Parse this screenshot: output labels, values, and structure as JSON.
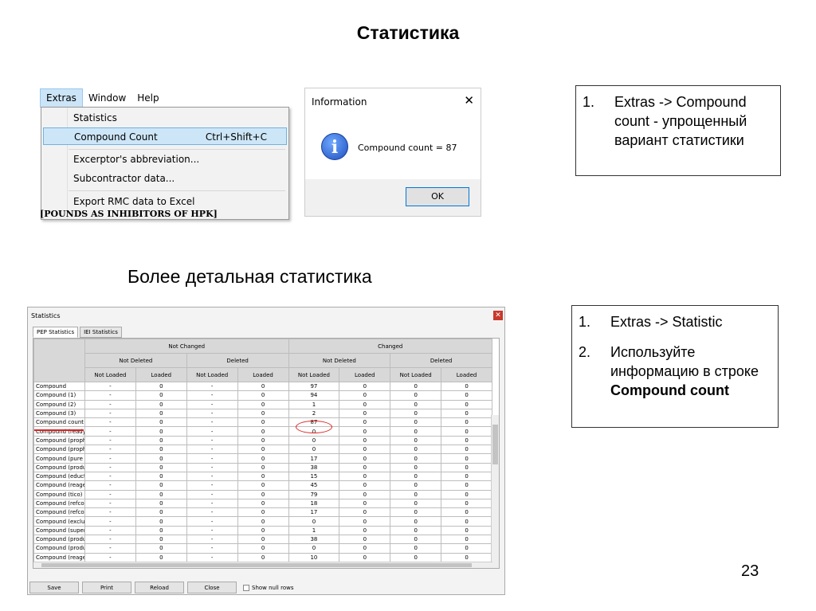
{
  "slide": {
    "title": "Статистика",
    "subtitle": "Более детальная статистика",
    "page_number": "23"
  },
  "callout1": {
    "items": [
      {
        "num": "1.",
        "text": "Extras -> Compound count - упрощенный вариант статистики"
      }
    ]
  },
  "callout2": {
    "items": [
      {
        "num": "1.",
        "text": "Extras -> Statistic"
      },
      {
        "num": "2.",
        "text_prefix": "Используйте информацию в строке ",
        "text_bold": "Compound count"
      }
    ]
  },
  "menu": {
    "bar": [
      "Extras",
      "Window",
      "Help"
    ],
    "items": [
      {
        "label": "Statistics",
        "shortcut": ""
      },
      {
        "label": "Compound Count",
        "shortcut": "Ctrl+Shift+C"
      },
      {
        "label": "Excerptor's abbreviation...",
        "shortcut": ""
      },
      {
        "label": "Subcontractor data...",
        "shortcut": ""
      },
      {
        "label": "Export RMC data to Excel",
        "shortcut": ""
      }
    ],
    "peek_text": "[POUNDS AS INHIBITORS OF HPK]"
  },
  "info_dialog": {
    "title": "Information",
    "close": "✕",
    "icon": "info-icon",
    "message": "Compound count = 87",
    "ok_label": "OK"
  },
  "stat_window": {
    "title": "Statistics",
    "close": "✕",
    "tabs": [
      "PEP Statistics",
      "IEI Statistics"
    ],
    "headers": {
      "top": [
        "Not Changed",
        "Changed"
      ],
      "mid": [
        "Not Deleted",
        "Deleted",
        "Not Deleted",
        "Deleted"
      ],
      "low": [
        "Not Loaded",
        "Loaded",
        "Not Loaded",
        "Loaded",
        "Not Loaded",
        "Loaded",
        "Not Loaded",
        "Loaded"
      ]
    },
    "rows": [
      [
        "Compound",
        "-",
        "0",
        "-",
        "0",
        "97",
        "0",
        "0",
        "0"
      ],
      [
        "Compound (1)",
        "-",
        "0",
        "-",
        "0",
        "94",
        "0",
        "0",
        "0"
      ],
      [
        "Compound (2)",
        "-",
        "0",
        "-",
        "0",
        "1",
        "0",
        "0",
        "0"
      ],
      [
        "Compound (3)",
        "-",
        "0",
        "-",
        "0",
        "2",
        "0",
        "0",
        "0"
      ],
      [
        "Compound count",
        "-",
        "0",
        "-",
        "0",
        "87",
        "0",
        "0",
        "0"
      ],
      [
        "Compound (ready)",
        "-",
        "0",
        "-",
        "0",
        "0",
        "0",
        "0",
        "0"
      ],
      [
        "Compound (propho",
        "-",
        "0",
        "-",
        "0",
        "0",
        "0",
        "0",
        "0"
      ],
      [
        "Compound (propho",
        "-",
        "0",
        "-",
        "0",
        "0",
        "0",
        "0",
        "0"
      ],
      [
        "Compound (pure n",
        "-",
        "0",
        "-",
        "0",
        "17",
        "0",
        "0",
        "0"
      ],
      [
        "Compound (produc",
        "-",
        "0",
        "-",
        "0",
        "38",
        "0",
        "0",
        "0"
      ],
      [
        "Compound (educts",
        "-",
        "0",
        "-",
        "0",
        "15",
        "0",
        "0",
        "0"
      ],
      [
        "Compound (reager",
        "-",
        "0",
        "-",
        "0",
        "45",
        "0",
        "0",
        "0"
      ],
      [
        "Compound (tico)",
        "-",
        "0",
        "-",
        "0",
        "79",
        "0",
        "0",
        "0"
      ],
      [
        "Compound (refco)",
        "-",
        "0",
        "-",
        "0",
        "18",
        "0",
        "0",
        "0"
      ],
      [
        "Compound (refco n",
        "-",
        "0",
        "-",
        "0",
        "17",
        "0",
        "0",
        "0"
      ],
      [
        "Compound (exclusi",
        "-",
        "0",
        "-",
        "0",
        "0",
        "0",
        "0",
        "0"
      ],
      [
        "Compound (superf",
        "-",
        "0",
        "-",
        "0",
        "1",
        "0",
        "0",
        "0"
      ],
      [
        "Compound (produc",
        "-",
        "0",
        "-",
        "0",
        "38",
        "0",
        "0",
        "0"
      ],
      [
        "Compound (produc",
        "-",
        "0",
        "-",
        "0",
        "0",
        "0",
        "0",
        "0"
      ],
      [
        "Compound (reager",
        "-",
        "0",
        "-",
        "0",
        "10",
        "0",
        "0",
        "0"
      ]
    ],
    "buttons": [
      "Save",
      "Print",
      "Reload",
      "Close"
    ],
    "checkbox_label": "Show null rows"
  }
}
